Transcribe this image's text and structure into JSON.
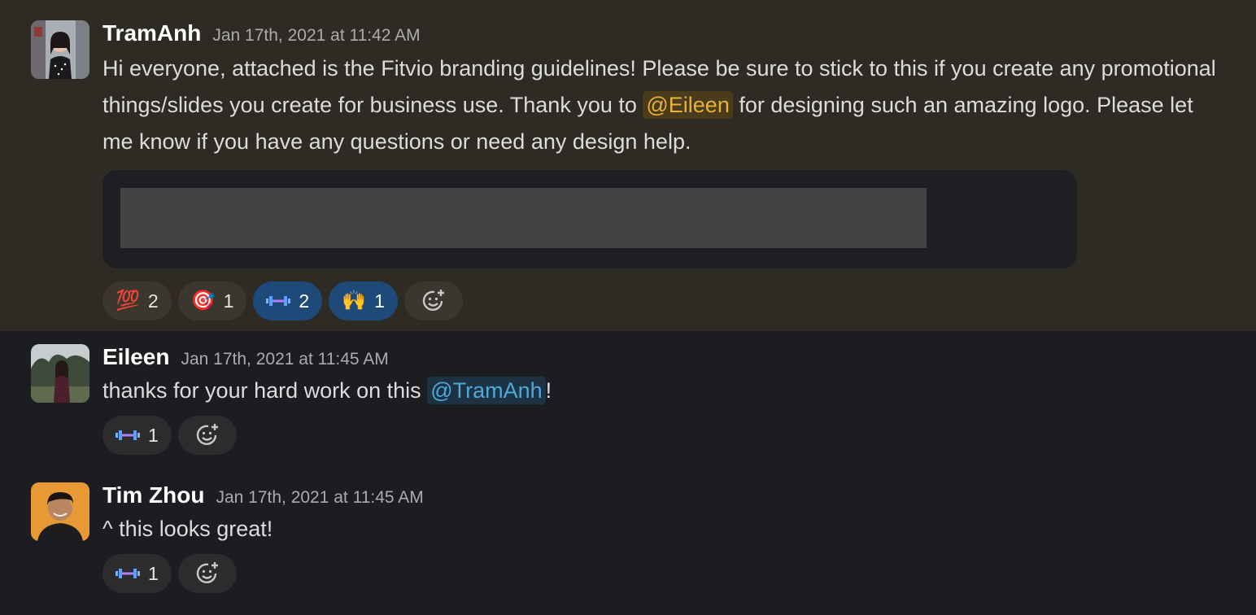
{
  "messages": [
    {
      "author": "TramAnh",
      "timestamp": "Jan 17th, 2021 at 11:42 AM",
      "text_1": "Hi everyone, attached is the Fitvio branding guidelines! Please be sure to stick to this if you create any promotional things/slides you create for business use. Thank you to ",
      "mention": "@Eileen",
      "text_2": " for designing such an amazing logo. Please let me know if you have any questions or need any design help.",
      "reactions": [
        {
          "emoji": "💯",
          "count": "2"
        },
        {
          "emoji": "🎯",
          "count": "1"
        },
        {
          "emoji": "dumbbell-icon",
          "count": "2"
        },
        {
          "emoji": "🙌",
          "count": "1"
        }
      ]
    },
    {
      "author": "Eileen",
      "timestamp": "Jan 17th, 2021 at 11:45 AM",
      "text_1": "thanks for your hard work on this ",
      "mention": "@TramAnh",
      "text_2": "!",
      "reactions": [
        {
          "emoji": "dumbbell-icon",
          "count": "1"
        }
      ]
    },
    {
      "author": "Tim Zhou",
      "timestamp": "Jan 17th, 2021 at 11:45 AM",
      "text_1": "^ this looks great!",
      "reactions": [
        {
          "emoji": "dumbbell-icon",
          "count": "1"
        }
      ]
    }
  ],
  "colors": {
    "highlight_bg": "#2e2b24",
    "channel_bg": "#1b1d21",
    "active_reaction": "#1d4a78",
    "mention_self": "#e8b23a",
    "mention_other": "#4ea9dc"
  }
}
